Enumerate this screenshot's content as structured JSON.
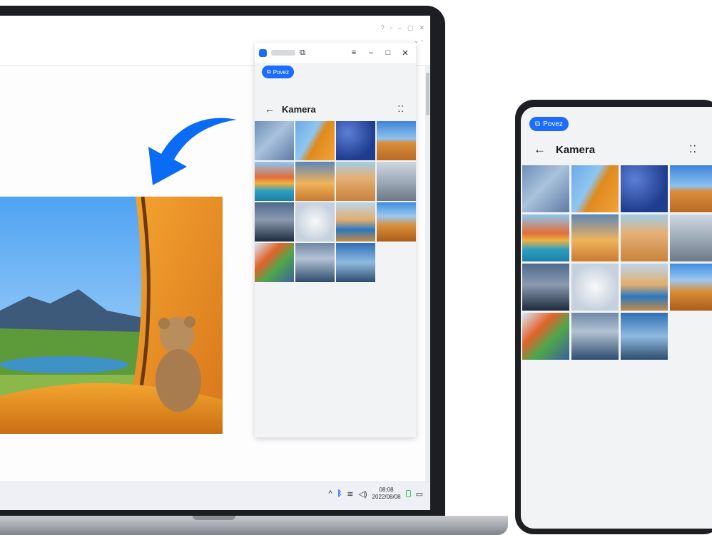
{
  "laptop": {
    "taskbar": {
      "time": "08:08",
      "date": "2022/08/08"
    }
  },
  "mirror_window": {
    "connect_label": "Povez",
    "album_title": "Kamera"
  },
  "phone": {
    "connect_label": "Povez",
    "album_title": "Kamera"
  },
  "icons": {
    "back": "back-arrow-icon",
    "more": "more-icon",
    "connect": "multi-screen-icon"
  },
  "colors": {
    "accent": "#1b6cff",
    "arrow": "#0a6cf5"
  },
  "photos": [
    {
      "name": "succulent",
      "bg": "linear-gradient(135deg,#6e8fb8,#a9c2dd 45%,#5d7aa3)"
    },
    {
      "name": "tent-view",
      "bg": "linear-gradient(120deg,#6ea9e8 0%,#8fc6f0 40%,#e08a1e 55%,#f2a23a 100%)"
    },
    {
      "name": "blueberries",
      "bg": "radial-gradient(circle at 30% 30%,#5d7fd6,#1f3c8f 70%)"
    },
    {
      "name": "desert-dune",
      "bg": "linear-gradient(180deg,#3f84d8 0%,#8ec1ef 45%,#d98f3e 55%,#b96a22 100%)"
    },
    {
      "name": "canal-city",
      "bg": "linear-gradient(180deg,#8cc7ef 0%,#e26d3a 40%,#f0b23f 55%,#2c9ec2 75%,#1f7fa8 100%)"
    },
    {
      "name": "sunset-sky",
      "bg": "linear-gradient(180deg,#5d86b8 0%,#f0b35a 55%,#c97a30 100%)"
    },
    {
      "name": "camel-caravan",
      "bg": "linear-gradient(180deg,#a0cde8 0%,#e5b077 40%,#c9833a 100%)"
    },
    {
      "name": "cliff-jumper",
      "bg": "linear-gradient(180deg,#cfd8e2 0%,#9aa6b4 55%,#6e7888 100%)"
    },
    {
      "name": "fishing-net",
      "bg": "linear-gradient(180deg,#4f6a8c 0%,#8a9ab0 45%,#1d2a3d 100%)"
    },
    {
      "name": "dandelion",
      "bg": "radial-gradient(circle at 50% 50%,#f8f9fb,#c6d1de 70%)"
    },
    {
      "name": "desert-river",
      "bg": "linear-gradient(180deg,#bcd6ea 0%,#e2ad6d 45%,#2b78c0 70%,#c58a44 100%)"
    },
    {
      "name": "camels-dunes",
      "bg": "linear-gradient(180deg,#3e8ee0 0%,#9cc7ee 35%,#d88d36 60%,#a95d1a 100%)"
    },
    {
      "name": "skier",
      "bg": "linear-gradient(135deg,#d8e8f8 0%,#e2622a 35%,#4fa74a 60%,#3b5f9e 100%)"
    },
    {
      "name": "pier-night",
      "bg": "linear-gradient(180deg,#6f87a6 0%,#b2c2d3 40%,#2f4c6e 100%)"
    },
    {
      "name": "coast-islands",
      "bg": "linear-gradient(180deg,#2f6fb5 0%,#8fb9e0 50%,#2c4d6e 100%)"
    }
  ]
}
